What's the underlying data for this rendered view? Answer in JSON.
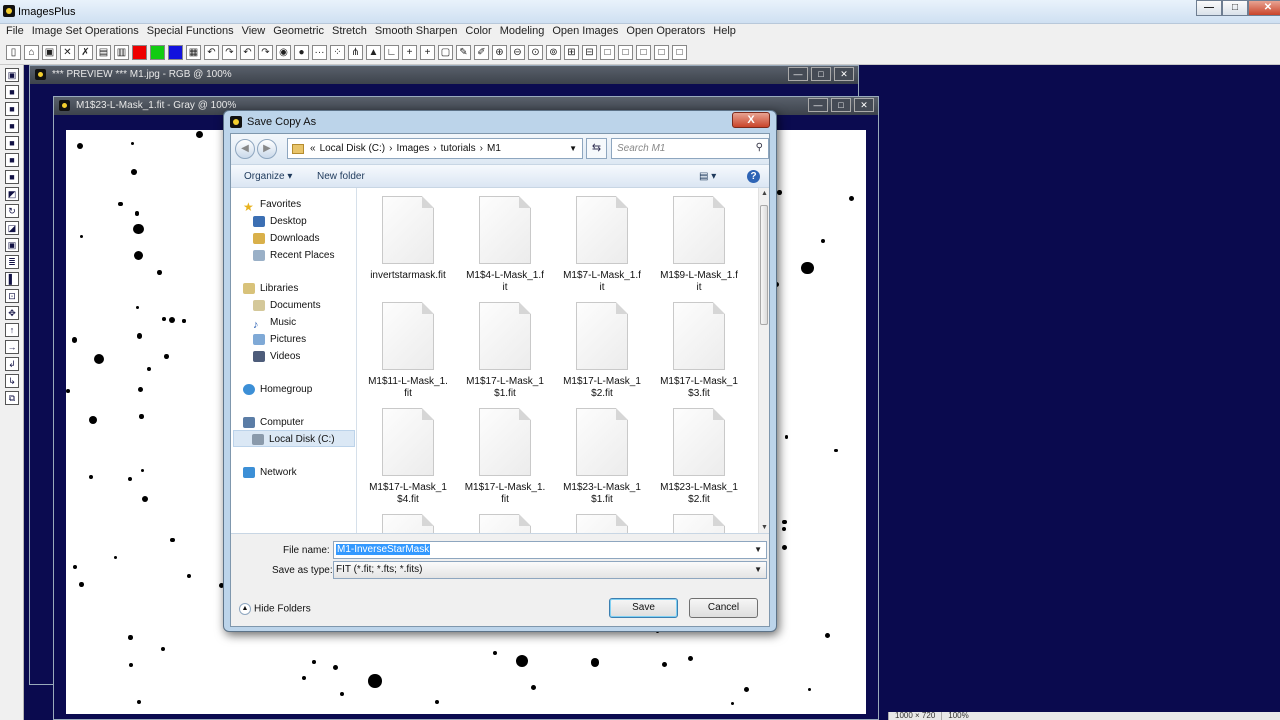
{
  "app": {
    "title": "ImagesPlus"
  },
  "menu": [
    "File",
    "Image Set Operations",
    "Special Functions",
    "View",
    "Geometric",
    "Stretch",
    "Smooth Sharpen",
    "Color",
    "Modeling",
    "Open Images",
    "Open Operators",
    "Help"
  ],
  "toolbar_icons": [
    "new-file-icon",
    "open-icon",
    "save-icon",
    "close-x-icon",
    "check-x-icon",
    "print-icon",
    "color-bars-icon",
    "red-swatch-icon",
    "green-swatch-icon",
    "blue-swatch-icon",
    "grid-icon",
    "undo-icon",
    "redo-icon",
    "undo-all-icon",
    "redo-all-icon",
    "target-icon",
    "record-icon",
    "dots-icon",
    "stars-icon",
    "node-icon",
    "triangle-icon",
    "axis-icon",
    "crosshair-plus-icon",
    "crosshair-icon",
    "frame-icon",
    "paint-icon",
    "pencil-icon",
    "zoom-in-icon",
    "zoom-out-icon",
    "zoom-fit-icon",
    "zoom-actual-icon",
    "plus-box-icon",
    "minus-box-icon",
    "square-icon",
    "square-icon",
    "square-icon",
    "square-icon",
    "square-icon"
  ],
  "windows": {
    "preview": {
      "title": "*** PREVIEW *** M1.jpg - RGB @ 100%"
    },
    "mask": {
      "title": "M1$23-L-Mask_1.fit - Gray @ 100%"
    }
  },
  "status": {
    "size": "1000 × 720",
    "zoom": "100%"
  },
  "dialog": {
    "title": "Save Copy As",
    "close_label": "X",
    "address": {
      "prefix": "«",
      "crumbs": [
        "Local Disk (C:)",
        "Images",
        "tutorials",
        "M1"
      ]
    },
    "search_placeholder": "Search M1",
    "commands": {
      "organize": "Organize ▾",
      "new_folder": "New folder"
    },
    "nav": {
      "favorites": "Favorites",
      "desktop": "Desktop",
      "downloads": "Downloads",
      "recent": "Recent Places",
      "libraries": "Libraries",
      "documents": "Documents",
      "music": "Music",
      "pictures": "Pictures",
      "videos": "Videos",
      "homegroup": "Homegroup",
      "computer": "Computer",
      "localdisk": "Local Disk (C:)",
      "network": "Network"
    },
    "files": [
      {
        "line1": "invertstarmask.fit",
        "line2": ""
      },
      {
        "line1": "M1$4-L-Mask_1.f",
        "line2": "it"
      },
      {
        "line1": "M1$7-L-Mask_1.f",
        "line2": "it"
      },
      {
        "line1": "M1$9-L-Mask_1.f",
        "line2": "it"
      },
      {
        "line1": "M1$11-L-Mask_1.",
        "line2": "fit"
      },
      {
        "line1": "M1$17-L-Mask_1",
        "line2": "$1.fit"
      },
      {
        "line1": "M1$17-L-Mask_1",
        "line2": "$2.fit"
      },
      {
        "line1": "M1$17-L-Mask_1",
        "line2": "$3.fit"
      },
      {
        "line1": "M1$17-L-Mask_1",
        "line2": "$4.fit"
      },
      {
        "line1": "M1$17-L-Mask_1.",
        "line2": "fit"
      },
      {
        "line1": "M1$23-L-Mask_1",
        "line2": "$1.fit"
      },
      {
        "line1": "M1$23-L-Mask_1",
        "line2": "$2.fit"
      },
      {
        "line1": "",
        "line2": ""
      },
      {
        "line1": "",
        "line2": ""
      },
      {
        "line1": "",
        "line2": ""
      },
      {
        "line1": "",
        "line2": ""
      }
    ],
    "filename_label": "File name:",
    "filename_value": "M1-InverseStarMask",
    "type_label": "Save as type:",
    "type_value": "FIT (*.fit; *.fts; *.fits)",
    "hide_folders": "Hide Folders",
    "save": "Save",
    "cancel": "Cancel"
  }
}
